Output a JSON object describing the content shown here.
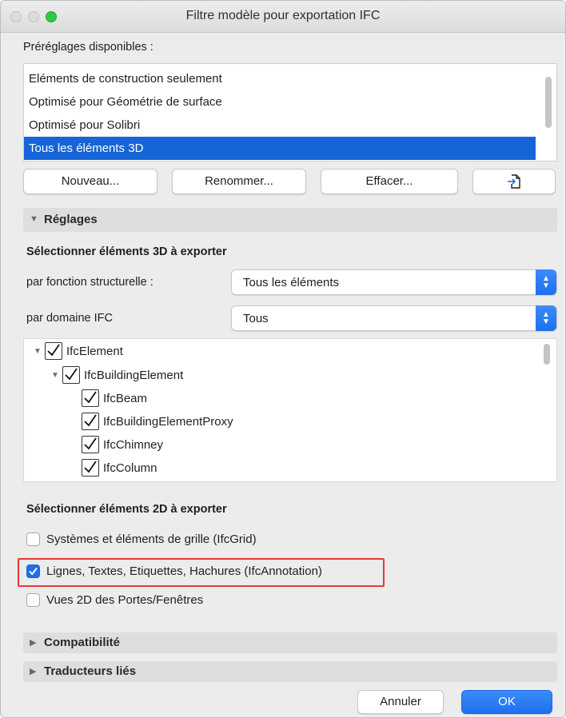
{
  "window": {
    "title": "Filtre modèle pour exportation IFC"
  },
  "presets": {
    "label": "Préréglages disponibles :",
    "items": [
      {
        "label": "Eléments de construction seulement",
        "selected": false
      },
      {
        "label": "Optimisé pour Géométrie de surface",
        "selected": false
      },
      {
        "label": "Optimisé pour Solibri",
        "selected": false
      },
      {
        "label": "Tous les éléments 3D",
        "selected": true
      }
    ],
    "buttons": {
      "new": "Nouveau...",
      "rename": "Renommer...",
      "delete": "Effacer...",
      "import_icon": "import-file-icon"
    }
  },
  "settings": {
    "header": "Réglages",
    "select3d_title": "Sélectionner éléments 3D à exporter",
    "by_structural_label": "par fonction structurelle :",
    "by_structural_value": "Tous les éléments",
    "by_domain_label": "par domaine IFC",
    "by_domain_value": "Tous",
    "tree": [
      {
        "label": "IfcElement",
        "checked": true,
        "expanded": true
      },
      {
        "label": "IfcBuildingElement",
        "checked": true,
        "expanded": true
      },
      {
        "label": "IfcBeam",
        "checked": true
      },
      {
        "label": "IfcBuildingElementProxy",
        "checked": true
      },
      {
        "label": "IfcChimney",
        "checked": true
      },
      {
        "label": "IfcColumn",
        "checked": true
      }
    ],
    "select2d_title": "Sélectionner éléments 2D à exporter",
    "options2d": [
      {
        "label": "Systèmes et éléments de grille (IfcGrid)",
        "checked": false
      },
      {
        "label": "Lignes, Textes, Etiquettes, Hachures (IfcAnnotation)",
        "checked": true
      },
      {
        "label": "Vues 2D des Portes/Fenêtres",
        "checked": false
      }
    ]
  },
  "sections": {
    "compat": "Compatibilité",
    "translators": "Traducteurs liés"
  },
  "footer": {
    "cancel": "Annuler",
    "ok": "OK"
  },
  "colors": {
    "accent": "#1f6ff0",
    "selection": "#1565d8",
    "highlight": "#e53935"
  }
}
